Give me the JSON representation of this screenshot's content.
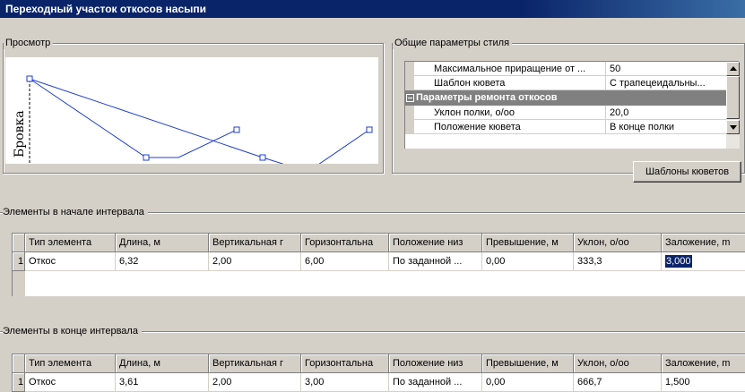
{
  "window": {
    "title": "Переходный участок откосов насыпи"
  },
  "preview": {
    "label": "Просмотр",
    "vertical_label": "Бровка"
  },
  "style_params": {
    "label": "Общие параметры стиля",
    "rows": [
      {
        "name": "Максимальное приращение от ...",
        "value": "50"
      },
      {
        "name": "Шаблон кювета",
        "value": "С трапецеидальны..."
      }
    ],
    "category": "Параметры ремонта откосов",
    "sub_rows": [
      {
        "name": "Уклон полки,  о/оо",
        "value": "20,0"
      },
      {
        "name": "Положение кювета",
        "value": "В конце полки"
      }
    ],
    "ditch_templates_button": "Шаблоны кюветов"
  },
  "start_elements": {
    "label": "Элементы в начале интервала",
    "columns": [
      "Тип элемента",
      "Длина, м",
      "Вертикальная г",
      "Горизонтальна",
      "Положение низ",
      "Превышение, м",
      "Уклон,  о/оо",
      "Заложение, m"
    ],
    "rows": [
      {
        "index": "1",
        "cells": [
          "Откос",
          "6,32",
          "2,00",
          "6,00",
          "По заданной ...",
          "0,00",
          "333,3",
          "3,000"
        ]
      }
    ]
  },
  "end_elements": {
    "label": "Элементы в конце интервала",
    "columns": [
      "Тип элемента",
      "Длина, м",
      "Вертикальная г",
      "Горизонтальна",
      "Положение низ",
      "Превышение, м",
      "Уклон,  о/оо",
      "Заложение, m"
    ],
    "rows": [
      {
        "index": "1",
        "cells": [
          "Откос",
          "3,61",
          "2,00",
          "3,00",
          "По заданной ...",
          "0,00",
          "666,7",
          "1,500"
        ]
      }
    ]
  },
  "colors": {
    "line": "#1f3fd0",
    "selection": "#0a246a",
    "titlebar": "#0a246a"
  }
}
